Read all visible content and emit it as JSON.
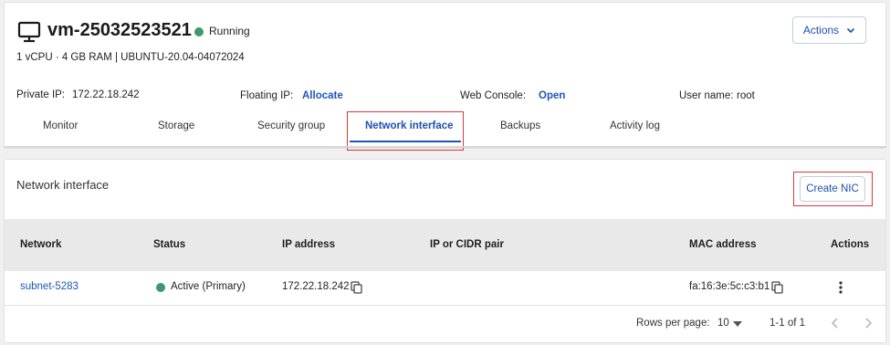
{
  "vm": {
    "name": "vm-25032523521",
    "status": "Running",
    "status_color": "#3a9b6a",
    "specs": "1 vCPU · 4 GB RAM | UBUNTU-20.04-04072024",
    "icon": "monitor-icon"
  },
  "header": {
    "actions_label": "Actions"
  },
  "info": {
    "private_ip_label": "Private IP:",
    "private_ip_value": "172.22.18.242",
    "floating_ip_label": "Floating IP:",
    "floating_ip_link": "Allocate",
    "web_console_label": "Web Console:",
    "web_console_link": "Open",
    "user_name_label": "User name:",
    "user_name_value": "root"
  },
  "tabs": [
    {
      "label": "Monitor"
    },
    {
      "label": "Storage"
    },
    {
      "label": "Security group"
    },
    {
      "label": "Network interface",
      "active": true
    },
    {
      "label": "Backups"
    },
    {
      "label": "Activity log"
    }
  ],
  "nic": {
    "title": "Network interface",
    "create_label": "Create NIC",
    "columns": [
      "Network",
      "Status",
      "IP address",
      "IP or CIDR pair",
      "MAC address",
      "Actions"
    ],
    "rows": [
      {
        "network": "subnet-5283",
        "status": "Active (Primary)",
        "ip_address": "172.22.18.242",
        "ip_or_cidr_pair": "",
        "mac_address": "fa:16:3e:5c:c3:b1"
      }
    ]
  },
  "pagination": {
    "rows_per_page_label": "Rows per page:",
    "rows_per_page_value": "10",
    "range": "1-1 of 1"
  },
  "colors": {
    "accent": "#1e56b8",
    "highlight_box": "#d9383a",
    "active_status": "#3a9b6a"
  }
}
